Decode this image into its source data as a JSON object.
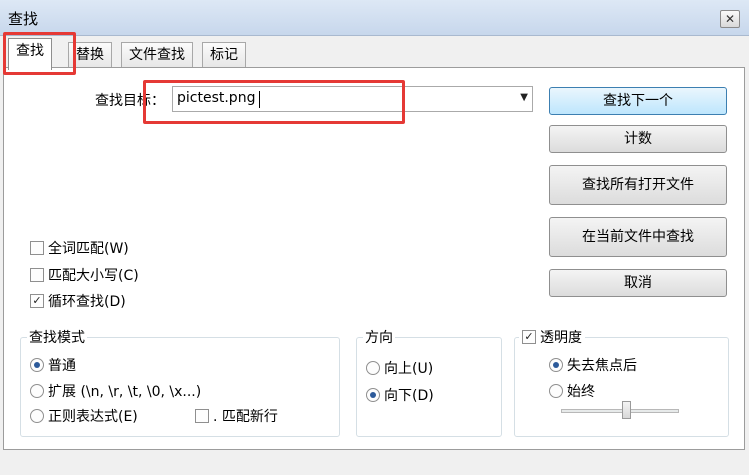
{
  "window": {
    "title": "查找",
    "close_glyph": "✕"
  },
  "tabs": [
    {
      "label": "查找",
      "active": true
    },
    {
      "label": "替换",
      "active": false
    },
    {
      "label": "文件查找",
      "active": false
    },
    {
      "label": "标记",
      "active": false
    }
  ],
  "find": {
    "label": "查找目标：",
    "value": "pictest.png"
  },
  "buttons": {
    "find_next": "查找下一个",
    "count": "计数",
    "find_all_open": "查找所有打开文件",
    "find_current": "在当前文件中查找",
    "cancel": "取消"
  },
  "options": {
    "whole_word": {
      "label": "全词匹配(W)",
      "checked": false
    },
    "match_case": {
      "label": "匹配大小写(C)",
      "checked": false
    },
    "wrap": {
      "label": "循环查找(D)",
      "checked": true
    }
  },
  "search_mode": {
    "title": "查找模式",
    "normal": "普通",
    "extended": "扩展 (\\n, \\r, \\t, \\0, \\x...)",
    "regex": "正则表达式(E)",
    "dot_newline": ". 匹配新行",
    "selected": "normal"
  },
  "direction": {
    "title": "方向",
    "up": "向上(U)",
    "down": "向下(D)",
    "selected": "down"
  },
  "transparency": {
    "label": "透明度",
    "checked": true,
    "on_lose_focus": "失去焦点后",
    "always": "始终",
    "selected": "on_lose_focus"
  }
}
